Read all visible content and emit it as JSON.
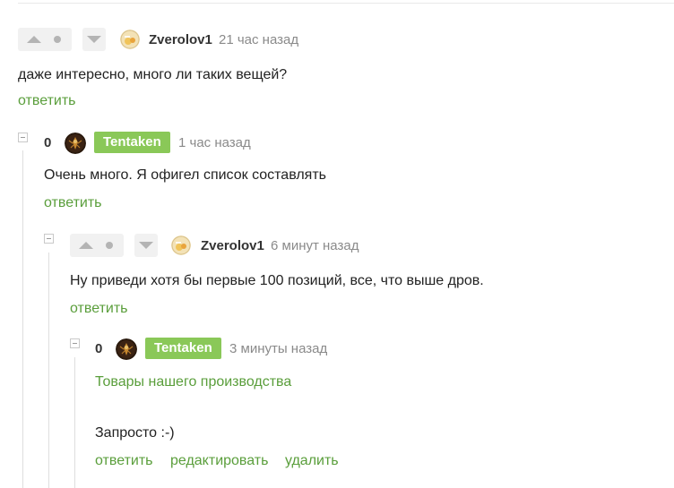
{
  "comment1": {
    "username": "Zverolov1",
    "time": "21 час назад",
    "text": "даже интересно, много ли таких вещей?",
    "reply": "ответить"
  },
  "comment2": {
    "rating": "0",
    "username": "Tentaken",
    "time": "1 час назад",
    "text": "Очень много. Я офигел список составлять",
    "reply": "ответить"
  },
  "comment3": {
    "username": "Zverolov1",
    "time": "6 минут назад",
    "text": "Ну приведи хотя бы первые 100 позиций, все, что выше дров.",
    "reply": "ответить"
  },
  "comment4": {
    "rating": "0",
    "username": "Tentaken",
    "time": "3 минуты назад",
    "link_text": "Товары нашего производства",
    "text": "Запросто :-)",
    "reply": "ответить",
    "edit": "редактировать",
    "delete": "удалить"
  },
  "colors": {
    "accent_green": "#5a9e3b",
    "badge_green": "#8ac858",
    "vote_bg": "#f1f1f1",
    "muted": "#8a8a8a"
  }
}
